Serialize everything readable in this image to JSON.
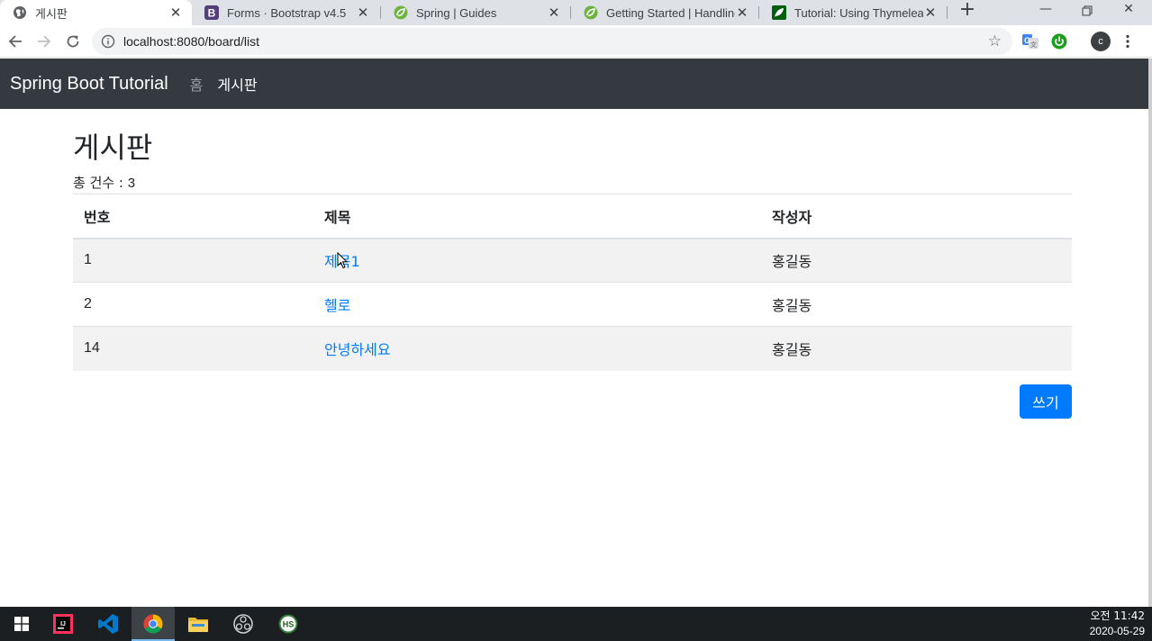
{
  "browser": {
    "tabs": [
      {
        "title": "게시판",
        "icon": "globe-icon",
        "active": true
      },
      {
        "title": "Forms · Bootstrap v4.5",
        "icon": "bootstrap-icon",
        "active": false
      },
      {
        "title": "Spring | Guides",
        "icon": "spring-icon",
        "active": false
      },
      {
        "title": "Getting Started | Handling",
        "icon": "spring-icon",
        "active": false
      },
      {
        "title": "Tutorial: Using Thymeleaf",
        "icon": "thymeleaf-icon",
        "active": false
      }
    ],
    "url": "localhost:8080/board/list",
    "profile_initial": "c"
  },
  "navbar": {
    "brand": "Spring Boot Tutorial",
    "links": [
      {
        "label": "홈",
        "active": false
      },
      {
        "label": "게시판",
        "active": true
      }
    ],
    "bg_color": "#343a40"
  },
  "board": {
    "title": "게시판",
    "total_label": "총 건수 : ",
    "total_count": "3",
    "columns": [
      "번호",
      "제목",
      "작성자"
    ],
    "rows": [
      {
        "id": "1",
        "title": "제목1",
        "author": "홍길동"
      },
      {
        "id": "2",
        "title": "헬로",
        "author": "홍길동"
      },
      {
        "id": "14",
        "title": "안녕하세요",
        "author": "홍길동"
      }
    ],
    "write_button": "쓰기",
    "accent_color": "#007bff"
  },
  "taskbar": {
    "apps": [
      "windows-start-icon",
      "intellij-icon",
      "vscode-icon",
      "chrome-icon",
      "file-explorer-icon",
      "obs-icon",
      "hs-icon"
    ],
    "time": "오전 11:42",
    "date": "2020-05-29"
  }
}
